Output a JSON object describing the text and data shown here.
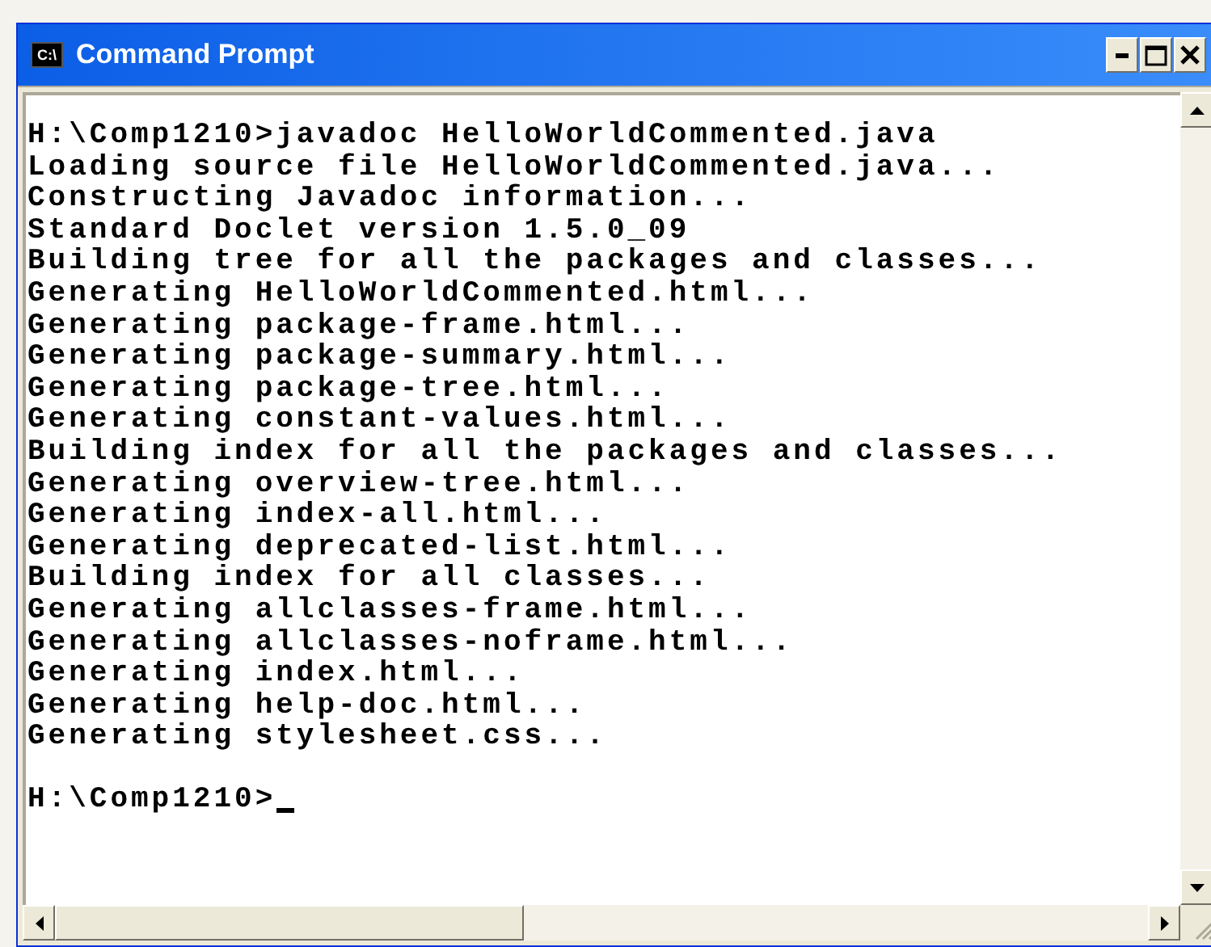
{
  "window": {
    "title": "Command Prompt",
    "icon_text": "C:\\"
  },
  "console": {
    "lines": [
      "H:\\Comp1210>javadoc HelloWorldCommented.java",
      "Loading source file HelloWorldCommented.java...",
      "Constructing Javadoc information...",
      "Standard Doclet version 1.5.0_09",
      "Building tree for all the packages and classes...",
      "Generating HelloWorldCommented.html...",
      "Generating package-frame.html...",
      "Generating package-summary.html...",
      "Generating package-tree.html...",
      "Generating constant-values.html...",
      "Building index for all the packages and classes...",
      "Generating overview-tree.html...",
      "Generating index-all.html...",
      "Generating deprecated-list.html...",
      "Building index for all classes...",
      "Generating allclasses-frame.html...",
      "Generating allclasses-noframe.html...",
      "Generating index.html...",
      "Generating help-doc.html...",
      "Generating stylesheet.css..."
    ],
    "prompt": "H:\\Comp1210>",
    "cursor": true
  }
}
